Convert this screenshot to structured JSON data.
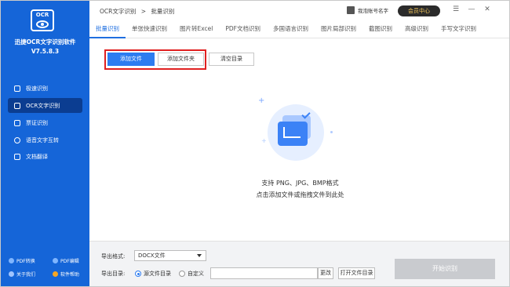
{
  "app": {
    "logo_text": "OCR",
    "name": "迅捷OCR文字识别软件",
    "version": "V7.5.8.3"
  },
  "sidebar": {
    "items": [
      {
        "label": "极速识别",
        "icon": "lightning-icon"
      },
      {
        "label": "OCR文字识别",
        "icon": "scan-icon"
      },
      {
        "label": "票证识别",
        "icon": "ticket-icon"
      },
      {
        "label": "语音文字互转",
        "icon": "microphone-icon"
      },
      {
        "label": "文档翻译",
        "icon": "translate-icon"
      }
    ],
    "bottom_links": [
      {
        "label": "PDF转换"
      },
      {
        "label": "PDF编辑"
      },
      {
        "label": "关于我们"
      },
      {
        "label": "软件帮助"
      }
    ]
  },
  "topbar": {
    "breadcrumb_root": "OCR文字识别",
    "breadcrumb_sep": ">",
    "breadcrumb_current": "批量识别",
    "user_name": "我泡账号名字",
    "vip_label": "会员中心",
    "win_buttons": [
      "☰",
      "—",
      "✕"
    ]
  },
  "tabs": [
    {
      "label": "批量识别",
      "active": true
    },
    {
      "label": "单张快速识别"
    },
    {
      "label": "图片转Excel"
    },
    {
      "label": "PDF文档识别"
    },
    {
      "label": "多国语言识别"
    },
    {
      "label": "图片局部识别"
    },
    {
      "label": "截图识别"
    },
    {
      "label": "高级识别"
    },
    {
      "label": "手写文字识别"
    }
  ],
  "toolbar": {
    "add_file": "添加文件",
    "add_folder": "添加文件夹",
    "clear_list": "清空目录"
  },
  "dropzone": {
    "formats": "支持 PNG、JPG、BMP格式",
    "instruction": "点击添加文件或拖拽文件到此处"
  },
  "output": {
    "format_label": "导出格式:",
    "format_value": "DOCX文件",
    "dir_label": "导出目录:",
    "option_source": "源文件目录",
    "option_custom": "自定义",
    "change_label": "更改",
    "open_dir_label": "打开文件目录",
    "start_label": "开始识别"
  },
  "colors": {
    "sidebar": "#1565d8",
    "accent": "#2d7cf0",
    "highlight_frame": "#e02020"
  }
}
